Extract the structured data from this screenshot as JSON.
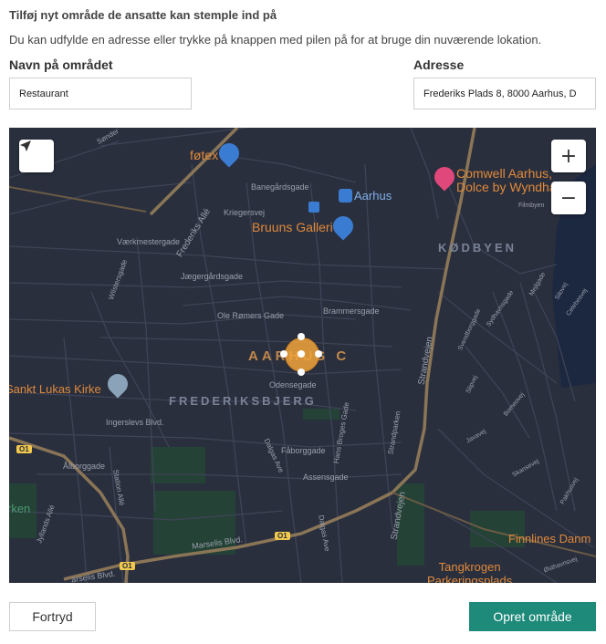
{
  "dialog": {
    "title": "Tilføj nyt område de ansatte kan stemple ind på",
    "description": "Du kan udfylde en adresse eller trykke på knappen med pilen på for at bruge din nuværende lokation."
  },
  "form": {
    "name_label": "Navn på området",
    "name_value": "Restaurant",
    "address_label": "Adresse",
    "address_value": "Frederiks Plads 8, 8000 Aarhus, D"
  },
  "map": {
    "controls": {
      "locate_icon": "navigation-arrow-icon",
      "zoom_in": "+",
      "zoom_out": "−"
    },
    "poi": {
      "fotex": "føtex",
      "comwell_1": "Comwell Aarhus,",
      "comwell_2": "Dolce by Wyndha",
      "aarhus": "Aarhus",
      "bruuns": "Bruuns Galleri",
      "sankt_lukas": "Sankt Lukas Kirke",
      "finnlines": "Finnlines Danm",
      "tangkrogen_1": "Tangkrogen",
      "tangkrogen_2": "Parkeringsplads",
      "parken": "rken"
    },
    "districts": {
      "kodbyen": "KØDBYEN",
      "aarhus_c": "AARHUS C",
      "frederiksbjerg": "FREDERIKSBJERG"
    },
    "streets": {
      "sonder": "Sønder",
      "banegardsgade": "Banegårdsgade",
      "kriegersvej": "Kriegersvej",
      "frederiks_alle": "Frederiks Allé",
      "vaerkmestergade": "Værkmestergade",
      "wilstersgade": "Wilstersgade",
      "jaegergardsgade": "Jægergårdsgade",
      "ole_romers": "Ole Rømers Gade",
      "brammersgade": "Brammersgade",
      "odensegade": "Odensegade",
      "ingerslevs": "Ingerslevs Blvd.",
      "alborggade": "Ålborggade",
      "faborggade": "Fåborggade",
      "assensgade": "Assensgade",
      "dalgas_1": "Dalgas Ave",
      "dalgas_2": "Dalgas Ave",
      "hans_broges": "Hans Broges Gade",
      "strandparken": "Strandparken",
      "strandvejen_1": "Strandvejen",
      "strandvejen_2": "Strandvejen",
      "station_alle": "Station Allé",
      "jyllands": "Jyllands Allé",
      "marselis_1": "Marselis Blvd.",
      "marselis_2": "arselis Blvd.",
      "filmbyen": "Filmbyen",
      "mejlgade": "Mejlgade",
      "svendborggade": "Svendborggade",
      "sydhavnsgade": "Sydhavnsgade",
      "siloej": "Silovej",
      "celebesvej": "Celebesvej",
      "bomeovej": "Bomeovej",
      "javavej": "Javavej",
      "skansevej": "Skansevej",
      "pakhusvej": "Pakhusvej",
      "osthavnsvej": "Østhavnsvej",
      "sliprej": "Slipvej"
    },
    "route_badges": [
      "O1",
      "O1",
      "O1"
    ],
    "colors": {
      "background": "#2a2f3e",
      "main_road": "#8a7556",
      "poi_orange": "#e0893a",
      "marker": "#f2a53a"
    }
  },
  "actions": {
    "cancel": "Fortryd",
    "create": "Opret område"
  }
}
